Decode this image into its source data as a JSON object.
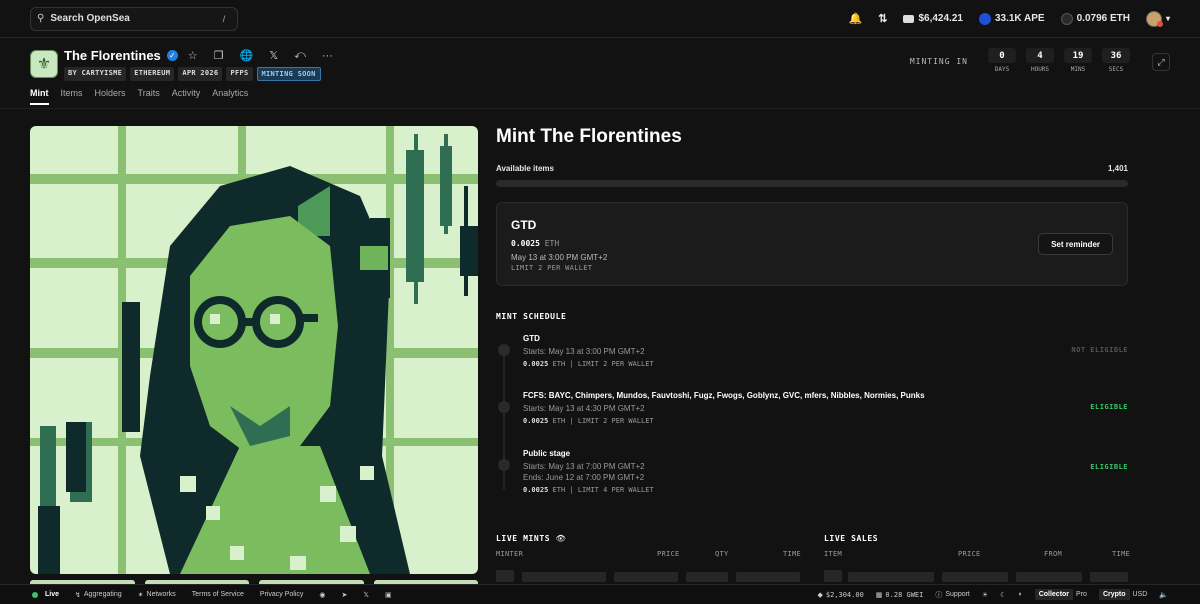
{
  "nav": {
    "search_placeholder": "Search OpenSea",
    "search_shortcut": "/",
    "balance": "$6,424.21",
    "ape": "33.1K APE",
    "eth": "0.0796 ETH"
  },
  "collection": {
    "title": "The Florentines",
    "badges": [
      "BY CARTYISME",
      "ETHEREUM",
      "APR 2026",
      "PFPS",
      "MINTING SOON"
    ],
    "minting_in_label": "MINTING IN",
    "countdown": [
      {
        "value": "0",
        "unit": "DAYS"
      },
      {
        "value": "4",
        "unit": "HOURS"
      },
      {
        "value": "19",
        "unit": "MINS"
      },
      {
        "value": "36",
        "unit": "SECS"
      }
    ]
  },
  "tabs": [
    "Mint",
    "Items",
    "Holders",
    "Traits",
    "Activity",
    "Analytics"
  ],
  "mint": {
    "title": "Mint The Florentines",
    "available_label": "Available items",
    "available_count": "1,401",
    "progress": 0,
    "active_stage": {
      "name": "GTD",
      "price": "0.0025",
      "currency": "ETH",
      "start": "May 13 at 3:00 PM GMT+2",
      "limit": "LIMIT 2 PER WALLET",
      "reminder": "Set reminder"
    },
    "schedule_title": "MINT SCHEDULE",
    "stages": [
      {
        "name": "GTD",
        "start": "Starts: May 13 at 3:00 PM GMT+2",
        "end": "",
        "price": "0.0025",
        "currency": "ETH",
        "limit": "LIMIT 2 PER WALLET",
        "status": "NOT ELIGIBLE",
        "color": "#555555"
      },
      {
        "name": "FCFS: BAYC, Chimpers, Mundos, Fauvtoshi, Fugz, Fwogs, Goblynz, GVC, mfers, Nibbles, Normies, Punks",
        "start": "Starts: May 13 at 4:30 PM GMT+2",
        "end": "",
        "price": "0.0025",
        "currency": "ETH",
        "limit": "LIMIT 2 PER WALLET",
        "status": "ELIGIBLE",
        "color": "#3ac36a"
      },
      {
        "name": "Public stage",
        "start": "Starts: May 13 at 7:00 PM GMT+2",
        "end": "Ends: June 12 at 7:00 PM GMT+2",
        "price": "0.0025",
        "currency": "ETH",
        "limit": "LIMIT 4 PER WALLET",
        "status": "ELIGIBLE",
        "color": "#3ac36a"
      }
    ]
  },
  "live_mints": {
    "title": "LIVE MINTS",
    "cols": [
      "MINTER",
      "PRICE",
      "QTY",
      "TIME"
    ]
  },
  "live_sales": {
    "title": "LIVE SALES",
    "cols": [
      "ITEM",
      "PRICE",
      "FROM",
      "TIME"
    ]
  },
  "footer": {
    "live": "Live",
    "aggregating": "Aggregating",
    "networks": "Networks",
    "terms": "Terms of Service",
    "privacy": "Privacy Policy",
    "eth_price": "$2,304.00",
    "gas": "0.28 GWEI",
    "support": "Support",
    "mode_a": "Collector",
    "mode_b": "Pro",
    "cur_a": "Crypto",
    "cur_b": "USD"
  }
}
